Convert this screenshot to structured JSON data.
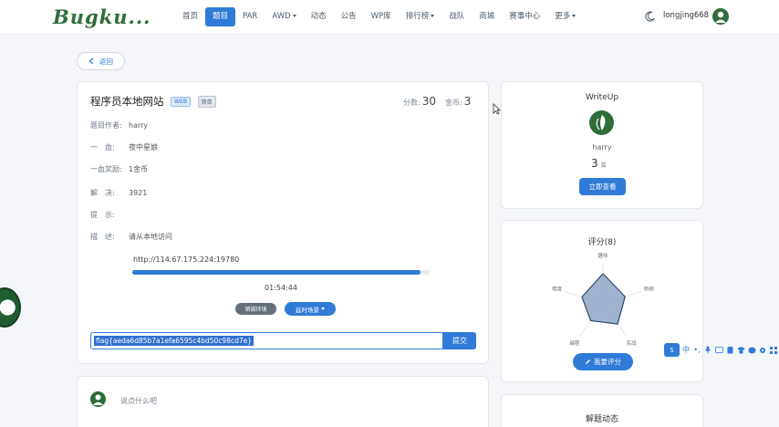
{
  "app": {
    "logo": "Bugku..."
  },
  "nav": {
    "items": [
      {
        "label": "首页",
        "active": false,
        "caret": false
      },
      {
        "label": "题目",
        "active": true,
        "caret": false
      },
      {
        "label": "PAR",
        "active": false,
        "caret": false
      },
      {
        "label": "AWD",
        "active": false,
        "caret": true
      },
      {
        "label": "动态",
        "active": false,
        "caret": false
      },
      {
        "label": "公告",
        "active": false,
        "caret": false
      },
      {
        "label": "WP库",
        "active": false,
        "caret": false
      },
      {
        "label": "排行榜",
        "active": false,
        "caret": true
      },
      {
        "label": "战队",
        "active": false,
        "caret": false
      },
      {
        "label": "商城",
        "active": false,
        "caret": false
      },
      {
        "label": "赛事中心",
        "active": false,
        "caret": false
      },
      {
        "label": "更多",
        "active": false,
        "caret": true
      }
    ],
    "username": "longjing668"
  },
  "back": {
    "label": "返回"
  },
  "challenge": {
    "title": "程序员本地网站",
    "tags": [
      "WEB",
      "简单"
    ],
    "points_label": "分数:",
    "points_value": "30",
    "gold_label": "金币:",
    "gold_value": "3",
    "fields": [
      {
        "label": "题目作者:",
        "value": "harry"
      },
      {
        "label": "一　血:",
        "value": "夜中星娘"
      },
      {
        "label": "一血奖励:",
        "value": "1金币"
      },
      {
        "label": "解　决:",
        "value": "3921"
      },
      {
        "label": "提　示:",
        "value": ""
      },
      {
        "label": "描　述:",
        "value": "请从本地访问"
      }
    ],
    "url": "http://114.67.175.224:19780",
    "progress": 0.97,
    "timer": "01:54:44",
    "destroy_btn": "销毁环境",
    "extend_btn": "延时场景",
    "flag_value": "flag{aeda6d85b7a1efa6595c4bd50c98cd7e}",
    "submit_btn": "提交"
  },
  "comment": {
    "placeholder": "说点什么吧"
  },
  "writeup": {
    "title": "WriteUp",
    "author": "harry",
    "count": "3",
    "count_unit": "篇",
    "view_btn": "立即查看"
  },
  "score": {
    "title": "评分(8)",
    "axes": [
      "趣味",
      "新颖",
      "实战",
      "编程",
      "难度"
    ],
    "values": [
      0.75,
      0.58,
      0.62,
      0.52,
      0.55
    ],
    "rate_btn": "我要评分"
  },
  "dynamics": {
    "title": "解题动态"
  },
  "toolbar": {
    "lang": "中"
  },
  "colors": {
    "accent": "#2f7bd7",
    "brand": "#2f6d3a"
  }
}
